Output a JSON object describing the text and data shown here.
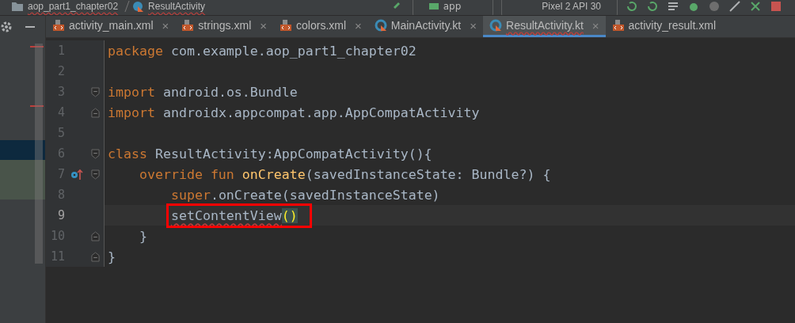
{
  "breadcrumb": [
    {
      "label": "aop_part1_chapter02",
      "kind": "folder",
      "error": true
    },
    {
      "label": "ResultActivity",
      "kind": "kotlin",
      "error": true
    }
  ],
  "run_config": {
    "label": "app"
  },
  "device": {
    "label": "Pixel 2 API 30"
  },
  "tabs": [
    {
      "label": "activity_main.xml",
      "kind": "xml",
      "selected": false,
      "error": false,
      "close": "×"
    },
    {
      "label": "strings.xml",
      "kind": "xml",
      "selected": false,
      "error": false,
      "close": "×"
    },
    {
      "label": "colors.xml",
      "kind": "xml",
      "selected": false,
      "error": false,
      "close": "×"
    },
    {
      "label": "MainActivity.kt",
      "kind": "kotlin",
      "selected": false,
      "error": false,
      "close": "×"
    },
    {
      "label": "ResultActivity.kt",
      "kind": "kotlin",
      "selected": true,
      "error": true,
      "close": "×"
    },
    {
      "label": "activity_result.xml",
      "kind": "xml",
      "selected": false,
      "error": false
    }
  ],
  "lines": [
    {
      "number": "1",
      "current": false,
      "fold_start": false,
      "fold_end": false,
      "override_marker": false,
      "boxed": false,
      "tokens": [
        {
          "text": "package",
          "kind": "keyword"
        },
        {
          "text": " com.example.aop_part1_chapter02",
          "kind": "plain"
        }
      ]
    },
    {
      "number": "2",
      "current": false,
      "fold_start": false,
      "fold_end": false,
      "override_marker": false,
      "boxed": false
    },
    {
      "number": "3",
      "current": false,
      "fold_start": true,
      "fold_end": false,
      "override_marker": false,
      "boxed": false,
      "tokens": [
        {
          "text": "import",
          "kind": "keyword"
        },
        {
          "text": " android.os.Bundle",
          "kind": "plain"
        }
      ]
    },
    {
      "number": "4",
      "current": false,
      "fold_start": false,
      "fold_end": true,
      "override_marker": false,
      "boxed": false,
      "tokens": [
        {
          "text": "import",
          "kind": "keyword"
        },
        {
          "text": " androidx.appcompat.app.AppCompatActivity",
          "kind": "plain"
        }
      ]
    },
    {
      "number": "5",
      "current": false,
      "fold_start": false,
      "fold_end": false,
      "override_marker": false,
      "boxed": false
    },
    {
      "number": "6",
      "current": false,
      "fold_start": true,
      "fold_end": false,
      "override_marker": false,
      "boxed": false,
      "tokens": [
        {
          "text": "class",
          "kind": "keyword"
        },
        {
          "text": " ResultActivity:AppCompatActivity(){",
          "kind": "plain"
        }
      ]
    },
    {
      "number": "7",
      "current": false,
      "fold_start": true,
      "fold_end": false,
      "override_marker": true,
      "boxed": false,
      "tokens": [
        {
          "text": "    override fun",
          "kind": "keyword"
        },
        {
          "text": " onCreate",
          "kind": "function"
        },
        {
          "text": "(savedInstanceState: Bundle?) {",
          "kind": "plain"
        }
      ]
    },
    {
      "number": "8",
      "current": false,
      "fold_start": false,
      "fold_end": false,
      "override_marker": false,
      "boxed": false,
      "tokens": [
        {
          "text": "        super",
          "kind": "keyword"
        },
        {
          "text": ".onCreate(savedInstanceState)",
          "kind": "plain"
        }
      ]
    },
    {
      "number": "9",
      "current": true,
      "fold_start": false,
      "fold_end": false,
      "override_marker": false,
      "boxed": true,
      "tokens": [
        {
          "text": "        setContentView",
          "kind": "error"
        },
        {
          "text": "()",
          "kind": "brace_match"
        }
      ]
    },
    {
      "number": "10",
      "current": false,
      "fold_start": false,
      "fold_end": true,
      "override_marker": false,
      "boxed": false,
      "tokens": [
        {
          "text": "    }",
          "kind": "plain"
        }
      ]
    },
    {
      "number": "11",
      "current": false,
      "fold_start": false,
      "fold_end": true,
      "override_marker": false,
      "boxed": false,
      "tokens": [
        {
          "text": "}",
          "kind": "plain"
        }
      ]
    }
  ]
}
